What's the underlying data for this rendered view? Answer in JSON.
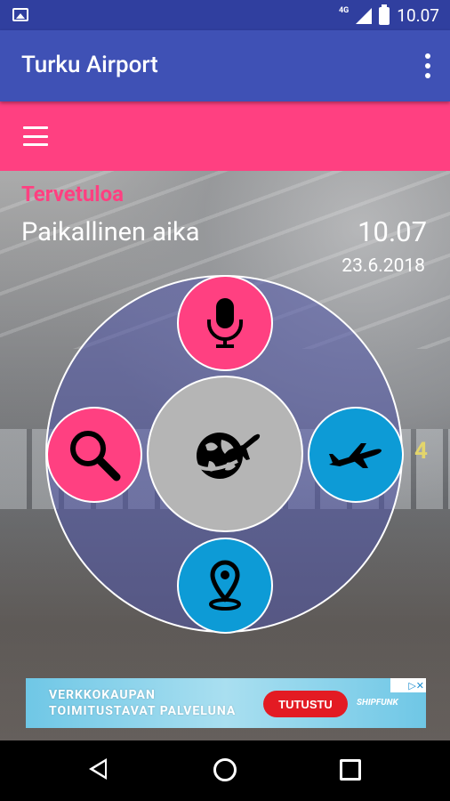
{
  "status_bar": {
    "network": "4G",
    "time": "10.07"
  },
  "app_bar": {
    "title": "Turku Airport"
  },
  "main": {
    "welcome": "Tervetuloa",
    "local_time_label": "Paikallinen aika",
    "local_time_value": "10.07",
    "date": "23.6.2018",
    "background_gate_number": "4"
  },
  "menu": {
    "center_icon": "globe-airplane-icon",
    "top_icon": "microphone-icon",
    "left_icon": "search-icon",
    "right_icon": "airplane-icon",
    "bottom_icon": "location-pin-icon",
    "colors": {
      "pink": "#FF4081",
      "blue": "#0D9BD6",
      "center": "#B5B5B5"
    }
  },
  "ad": {
    "text_line1": "VERKKOKAUPAN",
    "text_line2": "TOIMITUSTAVAT PALVELUNA",
    "button_label": "TUTUSTU",
    "brand": "SHIPFUNK"
  },
  "colors": {
    "primary": "#3F51B5",
    "primary_dark": "#303F9F",
    "accent": "#FF4081"
  }
}
